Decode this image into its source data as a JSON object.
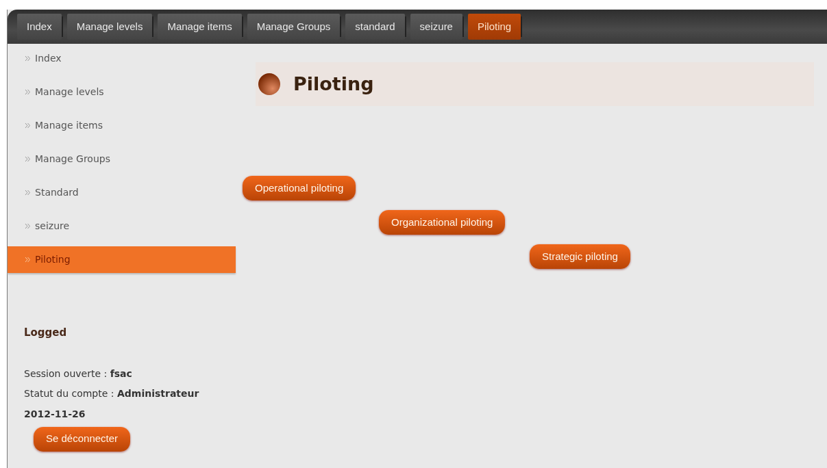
{
  "top_tabs": [
    {
      "label": "Index",
      "selected": false
    },
    {
      "label": "Manage levels",
      "selected": false
    },
    {
      "label": "Manage items",
      "selected": false
    },
    {
      "label": "Manage Groups",
      "selected": false
    },
    {
      "label": "standard",
      "selected": false
    },
    {
      "label": "seizure",
      "selected": false
    },
    {
      "label": "Piloting",
      "selected": true
    }
  ],
  "sidebar": {
    "items": [
      {
        "label": "Index",
        "selected": false
      },
      {
        "label": "Manage levels",
        "selected": false
      },
      {
        "label": "Manage items",
        "selected": false
      },
      {
        "label": "Manage Groups",
        "selected": false
      },
      {
        "label": "Standard",
        "selected": false
      },
      {
        "label": "seizure",
        "selected": false
      },
      {
        "label": "Piloting",
        "selected": true
      }
    ],
    "session": {
      "heading": "Logged",
      "lines": [
        "Session ouverte : **fsac**",
        "Statut du compte : **Administrateur**"
      ],
      "date": "2012-11-26",
      "logout_button": "Se déconnecter"
    }
  },
  "page": {
    "title": "Piloting",
    "buttons": [
      "Operational piloting",
      "Organizational piloting",
      "Strategic piloting"
    ]
  }
}
